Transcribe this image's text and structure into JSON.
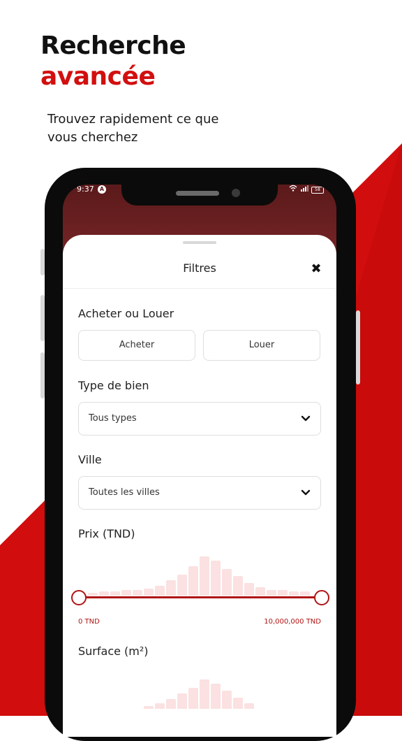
{
  "hero": {
    "title_line1": "Recherche",
    "title_line2": "avancée",
    "subtitle": "Trouvez rapidement ce que vous cherchez"
  },
  "status_bar": {
    "time": "9:37",
    "battery": "58"
  },
  "filters": {
    "title": "Filtres",
    "buy_rent": {
      "label": "Acheter ou Louer",
      "buy": "Acheter",
      "rent": "Louer"
    },
    "property_type": {
      "label": "Type de bien",
      "value": "Tous types"
    },
    "city": {
      "label": "Ville",
      "value": "Toutes les villes"
    },
    "price": {
      "label": "Prix (TND)",
      "min": "0 TND",
      "max": "10,000,000 TND"
    },
    "surface": {
      "label": "Surface (m²)"
    }
  },
  "colors": {
    "accent": "#d20f0f",
    "slider": "#b01414",
    "histogram": "#fbe1e1"
  },
  "icons": {
    "close": "close-icon",
    "chevron": "chevron-down-icon"
  }
}
